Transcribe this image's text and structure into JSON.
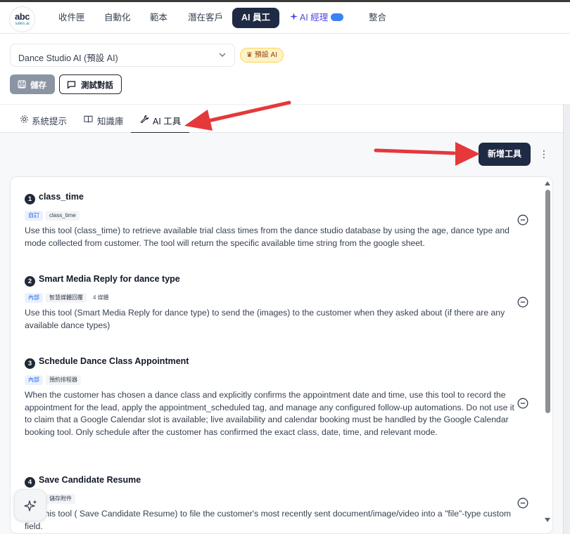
{
  "logo": {
    "line1": "abc",
    "line2": "sales.ai"
  },
  "nav": {
    "items": [
      "收件匣",
      "自動化",
      "範本",
      "潛在客戶",
      "AI 員工",
      "AI 經理",
      "整合"
    ],
    "active": "AI 員工"
  },
  "header": {
    "agent_select": "Dance Studio AI (預設 AI)",
    "default_badge": "預設 AI",
    "save_label": "儲存",
    "test_label": "測試對話"
  },
  "tabs": [
    "系統提示",
    "知識庫",
    "AI 工具"
  ],
  "active_tab": "AI 工具",
  "actions": {
    "add_tool": "新增工具",
    "more": "⋮"
  },
  "tools": [
    {
      "num": "1",
      "name": "class_time",
      "chips": [
        "自訂",
        "class_time"
      ],
      "description": "Use this tool (class_time) to retrieve available trial class times from the dance studio database by using the age, dance type and mode collected from customer. The tool will return the specific available time string from the google sheet."
    },
    {
      "num": "2",
      "name": "Smart Media Reply for dance type",
      "chips": [
        "內部",
        "智慧媒體回覆",
        "4 媒體"
      ],
      "description": "Use this tool (Smart Media Reply for dance type) to send the (images) to the customer when they asked about (if there are any available dance types)"
    },
    {
      "num": "3",
      "name": "Schedule Dance Class Appointment",
      "chips": [
        "內部",
        "預約排程器"
      ],
      "description": "When the customer has chosen a dance class and explicitly confirms the appointment date and time, use this tool to record the appointment for the lead, apply the appointment_scheduled tag, and manage any configured follow-up automations. Do not use it to claim that a Google Calendar slot is available; live availability and calendar booking must be handled by the Google Calendar booking tool. Only schedule after the customer has confirmed the exact class, date, time, and relevant mode."
    },
    {
      "num": "4",
      "name": "Save Candidate Resume",
      "chips": [
        "內部",
        "儲存附件"
      ],
      "description": "Use this tool ( Save Candidate Resume) to file the customer's most recently sent document/image/video into a \"file\"-type custom field."
    }
  ],
  "colors": {
    "primary": "#1f2a44",
    "arrow": "#e5383b",
    "accent_blue": "#2563eb",
    "default_badge_bg": "#fef3c7"
  }
}
